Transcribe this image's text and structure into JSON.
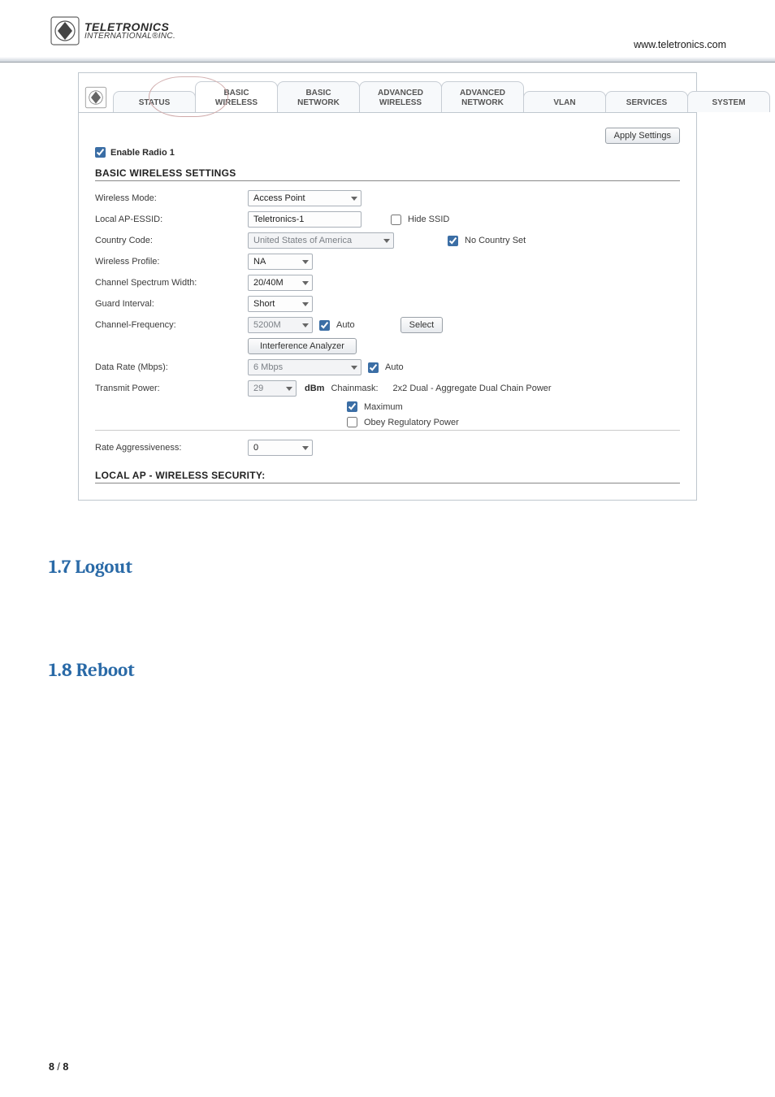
{
  "header": {
    "logo_line1": "TELETRONICS",
    "logo_line2": "INTERNATIONAL®INC.",
    "url": "www.teletronics.com"
  },
  "tabs": [
    {
      "l1": "STATUS",
      "l2": ""
    },
    {
      "l1": "BASIC",
      "l2": "WIRELESS"
    },
    {
      "l1": "BASIC",
      "l2": "NETWORK"
    },
    {
      "l1": "ADVANCED",
      "l2": "WIRELESS"
    },
    {
      "l1": "ADVANCED",
      "l2": "NETWORK"
    },
    {
      "l1": "VLAN",
      "l2": ""
    },
    {
      "l1": "SERVICES",
      "l2": ""
    },
    {
      "l1": "SYSTEM",
      "l2": ""
    }
  ],
  "apply_btn": "Apply Settings",
  "enable_radio": {
    "label": "Enable Radio 1",
    "checked": true
  },
  "section1_title": "BASIC WIRELESS SETTINGS",
  "rows": {
    "wireless_mode": {
      "label": "Wireless Mode:",
      "value": "Access Point"
    },
    "essid": {
      "label": "Local AP-ESSID:",
      "value": "Teletronics-1",
      "hide_label": "Hide SSID",
      "hide_checked": false
    },
    "country": {
      "label": "Country Code:",
      "value": "United States of America",
      "nc_label": "No Country Set",
      "nc_checked": true
    },
    "profile": {
      "label": "Wireless Profile:",
      "value": "NA"
    },
    "spectrum": {
      "label": "Channel Spectrum Width:",
      "value": "20/40M"
    },
    "guard": {
      "label": "Guard Interval:",
      "value": "Short"
    },
    "chan_freq": {
      "label": "Channel-Frequency:",
      "value": "5200M",
      "auto_label": "Auto",
      "auto_checked": true,
      "select_btn": "Select"
    },
    "interference_btn": "Interference Analyzer",
    "data_rate": {
      "label": "Data Rate (Mbps):",
      "value": "6 Mbps",
      "auto_label": "Auto",
      "auto_checked": true
    },
    "tx_power": {
      "label": "Transmit Power:",
      "value": "29",
      "dbm_label": "dBm",
      "cm_label": "Chainmask:",
      "cm_value": "2x2 Dual - Aggregate Dual Chain Power"
    },
    "maximum": {
      "label": "Maximum",
      "checked": true
    },
    "obey": {
      "label": "Obey Regulatory Power",
      "checked": false
    },
    "aggr": {
      "label": "Rate Aggressiveness:",
      "value": "0"
    }
  },
  "section2_title": "LOCAL AP - WIRELESS SECURITY:",
  "doc_headings": {
    "h17": "1.7 Logout",
    "h18": "1.8 Reboot"
  },
  "footer": {
    "current": "8",
    "sep": " / ",
    "total": "8"
  }
}
